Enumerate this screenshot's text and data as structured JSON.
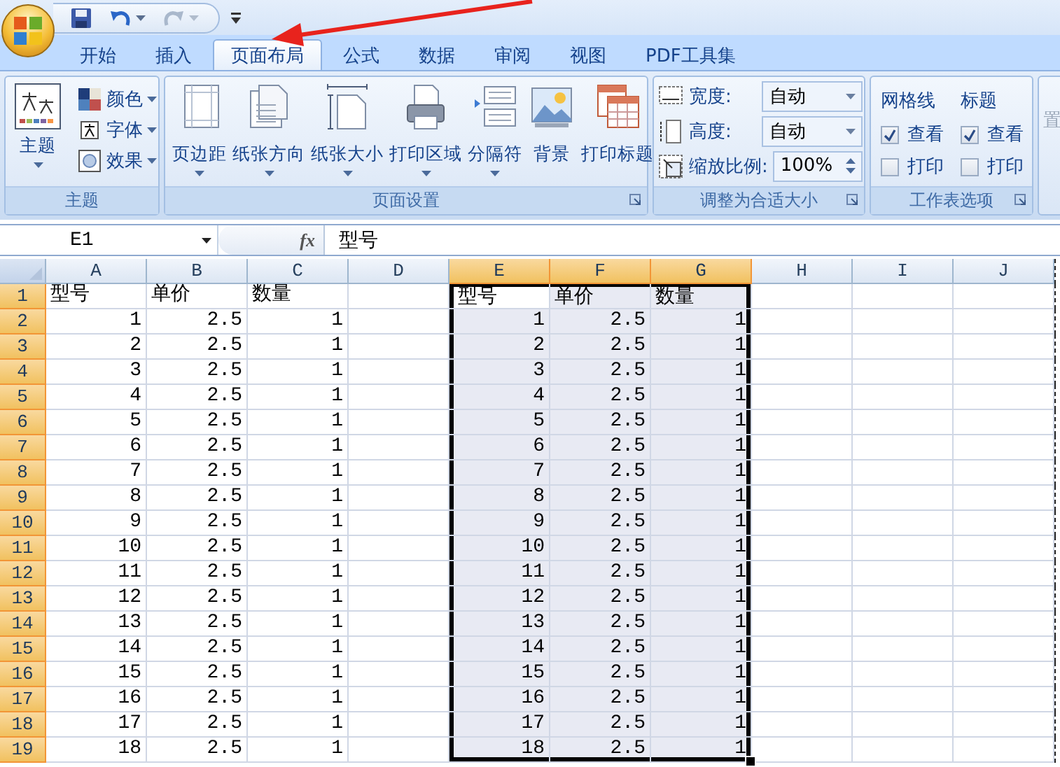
{
  "tabs": [
    {
      "label": "开始",
      "selected": false
    },
    {
      "label": "插入",
      "selected": false
    },
    {
      "label": "页面布局",
      "selected": true
    },
    {
      "label": "公式",
      "selected": false
    },
    {
      "label": "数据",
      "selected": false
    },
    {
      "label": "审阅",
      "selected": false
    },
    {
      "label": "视图",
      "selected": false
    },
    {
      "label": "PDF工具集",
      "selected": false
    }
  ],
  "ribbon": {
    "groups": [
      {
        "kind": "theme",
        "label": "主题",
        "launcher": false,
        "main": {
          "label": "主题",
          "dropdown": true
        },
        "options": [
          {
            "label": "颜色",
            "dropdown": true
          },
          {
            "label": "字体",
            "dropdown": true
          },
          {
            "label": "效果",
            "dropdown": true
          }
        ]
      },
      {
        "kind": "buttons",
        "label": "页面设置",
        "launcher": true,
        "buttons": [
          {
            "label": "页边距",
            "dropdown": true
          },
          {
            "label": "纸张方向",
            "dropdown": true
          },
          {
            "label": "纸张大小",
            "dropdown": true
          },
          {
            "label": "打印区域",
            "dropdown": true
          },
          {
            "label": "分隔符",
            "dropdown": true
          },
          {
            "label": "背景",
            "dropdown": false
          },
          {
            "label": "打印标题",
            "dropdown": false
          }
        ]
      },
      {
        "kind": "scale",
        "label": "调整为合适大小",
        "launcher": true,
        "fields": [
          {
            "kind": "dropdown",
            "label": "宽度:",
            "value": "自动"
          },
          {
            "kind": "dropdown",
            "label": "高度:",
            "value": "自动"
          },
          {
            "kind": "spinner",
            "label": "缩放比例:",
            "value": "100%"
          }
        ]
      },
      {
        "kind": "options",
        "label": "工作表选项",
        "launcher": true,
        "sections": [
          {
            "title": "网格线",
            "items": [
              {
                "label": "查看",
                "checked": true
              },
              {
                "label": "打印",
                "checked": false
              }
            ]
          },
          {
            "title": "标题",
            "items": [
              {
                "label": "查看",
                "checked": true
              },
              {
                "label": "打印",
                "checked": false
              }
            ]
          }
        ]
      },
      {
        "kind": "partial",
        "text": "置"
      }
    ]
  },
  "formula_bar": {
    "name_box": "E1",
    "function_label": "fx",
    "value": "型号"
  },
  "sheet": {
    "columns": [
      {
        "label": "A",
        "selected": false
      },
      {
        "label": "B",
        "selected": false
      },
      {
        "label": "C",
        "selected": false
      },
      {
        "label": "D",
        "selected": false
      },
      {
        "label": "E",
        "selected": true
      },
      {
        "label": "F",
        "selected": true
      },
      {
        "label": "G",
        "selected": true
      },
      {
        "label": "H",
        "selected": false
      },
      {
        "label": "I",
        "selected": false
      },
      {
        "label": "J",
        "selected": false
      }
    ],
    "rows": [
      {
        "number": "1",
        "selected": true,
        "active": true,
        "kind": "text",
        "cells": [
          "型号",
          "单价",
          "数量",
          null,
          "型号",
          "单价",
          "数量"
        ]
      },
      {
        "number": "2",
        "selected": true,
        "active": false,
        "kind": "number",
        "cells": [
          "1",
          "2.5",
          "1",
          null,
          "1",
          "2.5",
          "1"
        ]
      },
      {
        "number": "3",
        "selected": true,
        "active": false,
        "kind": "number",
        "cells": [
          "2",
          "2.5",
          "1",
          null,
          "2",
          "2.5",
          "1"
        ]
      },
      {
        "number": "4",
        "selected": true,
        "active": false,
        "kind": "number",
        "cells": [
          "3",
          "2.5",
          "1",
          null,
          "3",
          "2.5",
          "1"
        ]
      },
      {
        "number": "5",
        "selected": true,
        "active": false,
        "kind": "number",
        "cells": [
          "4",
          "2.5",
          "1",
          null,
          "4",
          "2.5",
          "1"
        ]
      },
      {
        "number": "6",
        "selected": true,
        "active": false,
        "kind": "number",
        "cells": [
          "5",
          "2.5",
          "1",
          null,
          "5",
          "2.5",
          "1"
        ]
      },
      {
        "number": "7",
        "selected": true,
        "active": false,
        "kind": "number",
        "cells": [
          "6",
          "2.5",
          "1",
          null,
          "6",
          "2.5",
          "1"
        ]
      },
      {
        "number": "8",
        "selected": true,
        "active": false,
        "kind": "number",
        "cells": [
          "7",
          "2.5",
          "1",
          null,
          "7",
          "2.5",
          "1"
        ]
      },
      {
        "number": "9",
        "selected": true,
        "active": false,
        "kind": "number",
        "cells": [
          "8",
          "2.5",
          "1",
          null,
          "8",
          "2.5",
          "1"
        ]
      },
      {
        "number": "10",
        "selected": true,
        "active": false,
        "kind": "number",
        "cells": [
          "9",
          "2.5",
          "1",
          null,
          "9",
          "2.5",
          "1"
        ]
      },
      {
        "number": "11",
        "selected": true,
        "active": false,
        "kind": "number",
        "cells": [
          "10",
          "2.5",
          "1",
          null,
          "10",
          "2.5",
          "1"
        ]
      },
      {
        "number": "12",
        "selected": true,
        "active": false,
        "kind": "number",
        "cells": [
          "11",
          "2.5",
          "1",
          null,
          "11",
          "2.5",
          "1"
        ]
      },
      {
        "number": "13",
        "selected": true,
        "active": false,
        "kind": "number",
        "cells": [
          "12",
          "2.5",
          "1",
          null,
          "12",
          "2.5",
          "1"
        ]
      },
      {
        "number": "14",
        "selected": true,
        "active": false,
        "kind": "number",
        "cells": [
          "13",
          "2.5",
          "1",
          null,
          "13",
          "2.5",
          "1"
        ]
      },
      {
        "number": "15",
        "selected": true,
        "active": false,
        "kind": "number",
        "cells": [
          "14",
          "2.5",
          "1",
          null,
          "14",
          "2.5",
          "1"
        ]
      },
      {
        "number": "16",
        "selected": true,
        "active": false,
        "kind": "number",
        "cells": [
          "15",
          "2.5",
          "1",
          null,
          "15",
          "2.5",
          "1"
        ]
      },
      {
        "number": "17",
        "selected": true,
        "active": false,
        "kind": "number",
        "cells": [
          "16",
          "2.5",
          "1",
          null,
          "16",
          "2.5",
          "1"
        ]
      },
      {
        "number": "18",
        "selected": true,
        "active": false,
        "kind": "number",
        "cells": [
          "17",
          "2.5",
          "1",
          null,
          "17",
          "2.5",
          "1"
        ]
      },
      {
        "number": "19",
        "selected": true,
        "active": false,
        "kind": "number",
        "cells": [
          "18",
          "2.5",
          "1",
          null,
          "18",
          "2.5",
          "1"
        ]
      }
    ]
  }
}
